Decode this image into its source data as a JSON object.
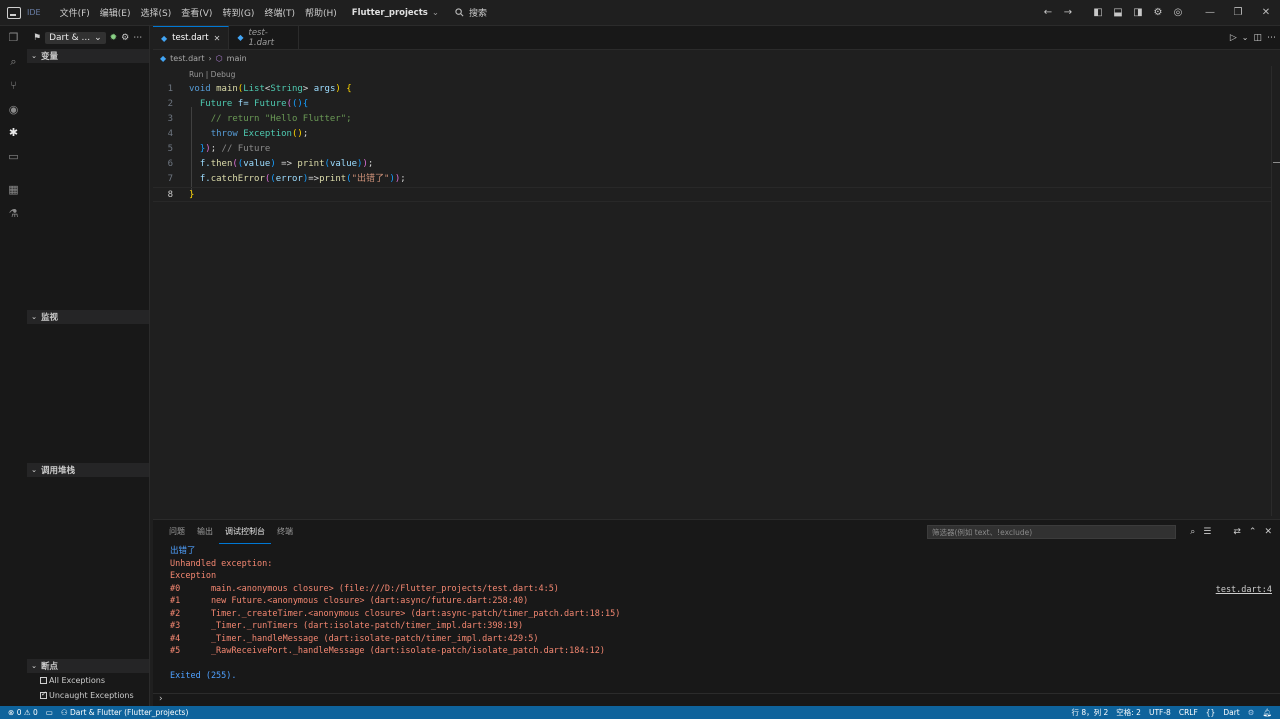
{
  "titlebar": {
    "ide_badge": "IDE",
    "menu": [
      "文件(F)",
      "编辑(E)",
      "选择(S)",
      "查看(V)",
      "转到(G)",
      "终端(T)",
      "帮助(H)"
    ],
    "project": "Flutter_projects",
    "search_label": "搜索"
  },
  "sidebar": {
    "config_name": "Dart & ...",
    "sections": {
      "variables": "变量",
      "watch": "监视",
      "callstack": "调用堆栈",
      "breakpoints": "断点"
    },
    "breakpoints": [
      {
        "label": "All Exceptions",
        "checked": false
      },
      {
        "label": "Uncaught Exceptions",
        "checked": true
      }
    ]
  },
  "editor": {
    "tabs": [
      {
        "label": "test.dart",
        "active": true
      },
      {
        "label": "test-1.dart",
        "active": false
      }
    ],
    "breadcrumb": {
      "file": "test.dart",
      "symbol": "main"
    },
    "codelens": "Run | Debug",
    "line_numbers": [
      "1",
      "2",
      "3",
      "4",
      "5",
      "6",
      "7",
      "8"
    ],
    "code": {
      "l1": [
        "void",
        "main",
        "(",
        "List",
        "<",
        "String",
        ">",
        "args",
        ")",
        "{"
      ],
      "l2": [
        "Future",
        "f=",
        "Future",
        "(",
        "(",
        ")",
        "{"
      ],
      "l3": "// return \"Hello Flutter\";",
      "l4": [
        "throw",
        "Exception",
        "(",
        ")",
        ";"
      ],
      "l5": [
        "}",
        ")",
        ";",
        "// Future"
      ],
      "l6": [
        "f.",
        "then",
        "(",
        "(",
        "value",
        ")",
        "=>",
        "print",
        "(",
        "value",
        ")",
        ")",
        ";"
      ],
      "l7": [
        "f.",
        "catchError",
        "(",
        "(",
        "error",
        ")",
        "=>",
        "print",
        "(",
        "\"出错了\"",
        ")",
        ")",
        ";"
      ],
      "l8": "}"
    }
  },
  "panel": {
    "tabs": [
      "问题",
      "输出",
      "调试控制台",
      "终端"
    ],
    "active_tab": "调试控制台",
    "filter_placeholder": "筛选器(例如 text、!exclude)",
    "output": [
      {
        "text": "出错了",
        "style": "blue"
      },
      {
        "text": "Unhandled exception:",
        "style": "red"
      },
      {
        "text": "Exception",
        "style": "red"
      },
      {
        "text": "#0      main.<anonymous closure> (file:///D:/Flutter_projects/test.dart:4:5)",
        "style": "red"
      },
      {
        "text": "#1      new Future.<anonymous closure> (dart:async/future.dart:258:40)",
        "style": "red"
      },
      {
        "text": "#2      Timer._createTimer.<anonymous closure> (dart:async-patch/timer_patch.dart:18:15)",
        "style": "red"
      },
      {
        "text": "#3      _Timer._runTimers (dart:isolate-patch/timer_impl.dart:398:19)",
        "style": "red"
      },
      {
        "text": "#4      _Timer._handleMessage (dart:isolate-patch/timer_impl.dart:429:5)",
        "style": "red"
      },
      {
        "text": "#5      _RawReceivePort._handleMessage (dart:isolate-patch/isolate_patch.dart:184:12)",
        "style": "red"
      },
      {
        "text": "Exited (255).",
        "style": "blue"
      }
    ],
    "source_link": "test.dart:4",
    "prompt": "›"
  },
  "statusbar": {
    "errors": "0",
    "warnings": "0",
    "debug_target": "Dart & Flutter (Flutter_projects)",
    "position": "行 8，列 2",
    "spaces": "空格: 2",
    "encoding": "UTF-8",
    "eol": "CRLF",
    "braces": "{}",
    "language": "Dart"
  },
  "icons": {
    "explorer": "files-icon",
    "search": "search-icon",
    "scm": "source-control-icon",
    "watch": "eye-icon",
    "debug": "bug-icon",
    "remote": "remote-icon",
    "extensions": "extensions-icon",
    "testing": "beaker-icon"
  },
  "colors": {
    "accent": "#0078d4",
    "statusbar": "#0e639c",
    "error_text": "#f48771",
    "info_text": "#4fa1ff"
  }
}
